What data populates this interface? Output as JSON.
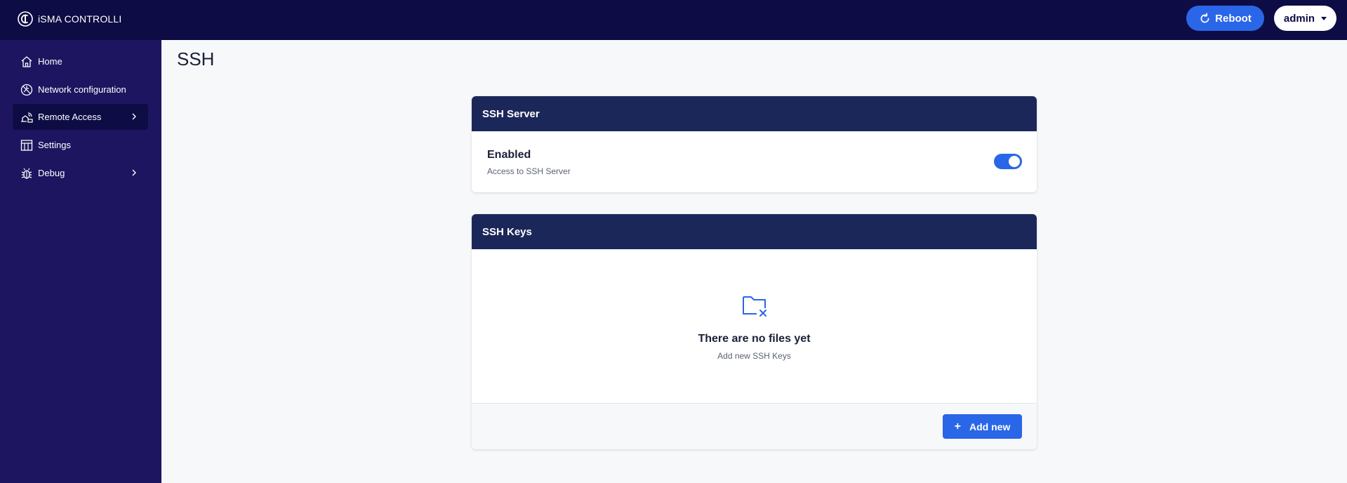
{
  "app": {
    "logo_text": "iSMA CONTROLLI",
    "reboot_label": "Reboot",
    "user_label": "admin"
  },
  "sidebar": {
    "items": [
      {
        "label": "Home",
        "icon": "home-icon"
      },
      {
        "label": "Network configuration",
        "icon": "network-icon"
      },
      {
        "label": "Remote Access",
        "icon": "remote-access-icon",
        "active": true,
        "has_submenu": true
      },
      {
        "label": "Settings",
        "icon": "settings-icon"
      },
      {
        "label": "Debug",
        "icon": "bug-icon",
        "has_submenu": true
      }
    ]
  },
  "page": {
    "title": "SSH"
  },
  "ssh_server": {
    "header": "SSH Server",
    "enabled_label": "Enabled",
    "enabled_desc": "Access to SSH Server",
    "enabled": true
  },
  "ssh_keys": {
    "header": "SSH Keys",
    "empty_title": "There are no files yet",
    "empty_sub": "Add new SSH Keys",
    "add_label": "Add new",
    "empty_icon": "folder-x-icon"
  },
  "colors": {
    "topbar": "#0e0c44",
    "sidebar": "#1e1560",
    "accent": "#2a66e8",
    "card_header": "#1c2759"
  }
}
